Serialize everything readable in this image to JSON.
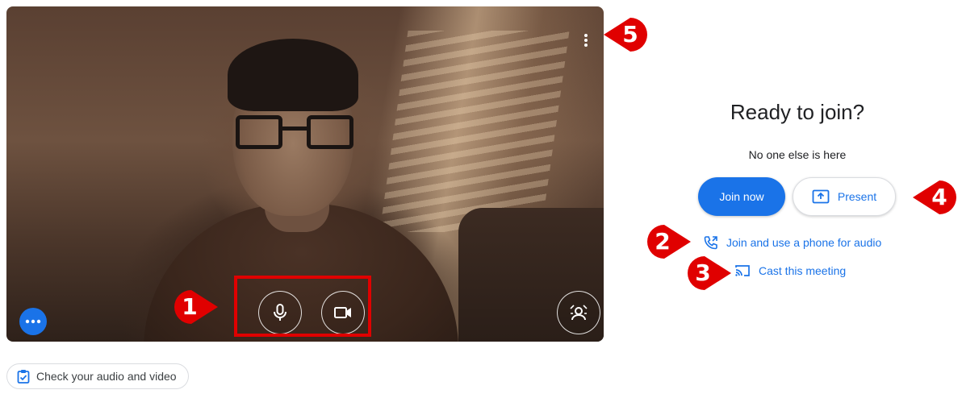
{
  "preview": {
    "more_options_icon": "three-dots-icon",
    "kebab_icon": "more-vert-icon",
    "mic_icon": "microphone-icon",
    "camera_icon": "video-camera-icon",
    "effects_icon": "visual-effects-icon"
  },
  "check_audio": {
    "label": "Check your audio and video",
    "icon": "clipboard-check-icon"
  },
  "panel": {
    "title": "Ready to join?",
    "status": "No one else is here",
    "join_label": "Join now",
    "present_label": "Present",
    "present_icon": "present-screen-icon",
    "phone_link": "Join and use a phone for audio",
    "phone_icon": "phone-icon",
    "cast_link": "Cast this meeting",
    "cast_icon": "cast-icon"
  },
  "markers": [
    "1",
    "2",
    "3",
    "4",
    "5"
  ],
  "colors": {
    "accent": "#1a73e8",
    "marker_red": "#e00000"
  }
}
